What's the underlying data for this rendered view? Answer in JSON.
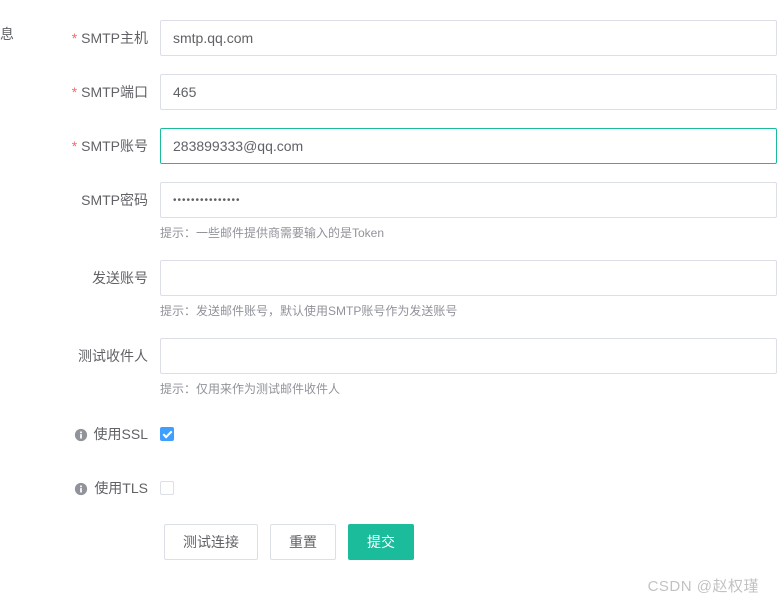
{
  "corner": "息",
  "fields": {
    "host": {
      "label": "SMTP主机",
      "value": "smtp.qq.com"
    },
    "port": {
      "label": "SMTP端口",
      "value": "465"
    },
    "account": {
      "label": "SMTP账号",
      "value": "283899333@qq.com"
    },
    "password": {
      "label": "SMTP密码",
      "value": "•••••••••••••••",
      "hint": "提示：一些邮件提供商需要输入的是Token"
    },
    "from": {
      "label": "发送账号",
      "value": "",
      "hint": "提示：发送邮件账号，默认使用SMTP账号作为发送账号"
    },
    "test_to": {
      "label": "测试收件人",
      "value": "",
      "hint": "提示：仅用来作为测试邮件收件人"
    },
    "ssl": {
      "label": "使用SSL",
      "checked": true
    },
    "tls": {
      "label": "使用TLS",
      "checked": false
    }
  },
  "buttons": {
    "test": "测试连接",
    "reset": "重置",
    "submit": "提交"
  },
  "watermark": "CSDN @赵权瑾"
}
